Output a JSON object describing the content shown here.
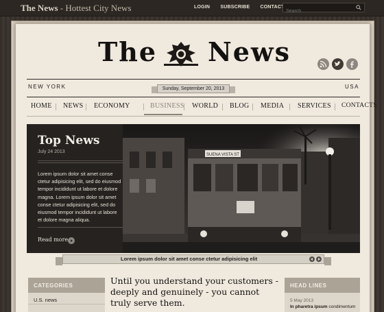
{
  "topbar": {
    "brand_name": "The News",
    "brand_tagline": " - Hottest City News",
    "links": [
      "LOGIN",
      "SUBSCRIBE",
      "CONTACT US"
    ],
    "search_placeholder": "Search"
  },
  "masthead": {
    "title_left": "The",
    "title_right": "News",
    "social": [
      "rss-icon",
      "twitter-icon",
      "facebook-icon"
    ]
  },
  "edition": {
    "city": "NEW YORK",
    "date": "Sunday, September 20, 2013",
    "country": "USA"
  },
  "nav": {
    "items": [
      "HOME",
      "NEWS",
      "ECONOMY",
      "BUSINESS",
      "WORLD",
      "BLOG",
      "MEDIA",
      "SERVICES",
      "CONTACTS"
    ],
    "active": "BUSINESS"
  },
  "hero": {
    "title": "Top News",
    "date": "July 24 2013",
    "body": "Lorem ipsum dolor sit amet conse ctetur adipisicing elit, sed do eiusmod tempor incididunt ut labore et dolore magna. Lorem ipsum dolor sit amet conse ctetur adipisicing elit, sed do eiusmod tempor incididunt ut labore et dolore magna aliqua.",
    "read_more": "Read more",
    "caption": "Lorem ipsum dolor sit amet conse ctetur adipisicing elit",
    "sign_text": "SUENA VISTA ST"
  },
  "categories": {
    "header": "CATEGORIES",
    "items": [
      "U.S. news"
    ]
  },
  "main_headline": "Until you understand your customers - deeply and genuinely - you cannot truly serve them.",
  "headlines": {
    "header": "HEAD LINES",
    "date": "5 May 2013",
    "text_bold": "In pharetra ipsum",
    "text_rest": " condimentum"
  },
  "colors": {
    "topbar": "#2c2723",
    "paper": "#efe9de",
    "accent_gray": "#aba395"
  }
}
